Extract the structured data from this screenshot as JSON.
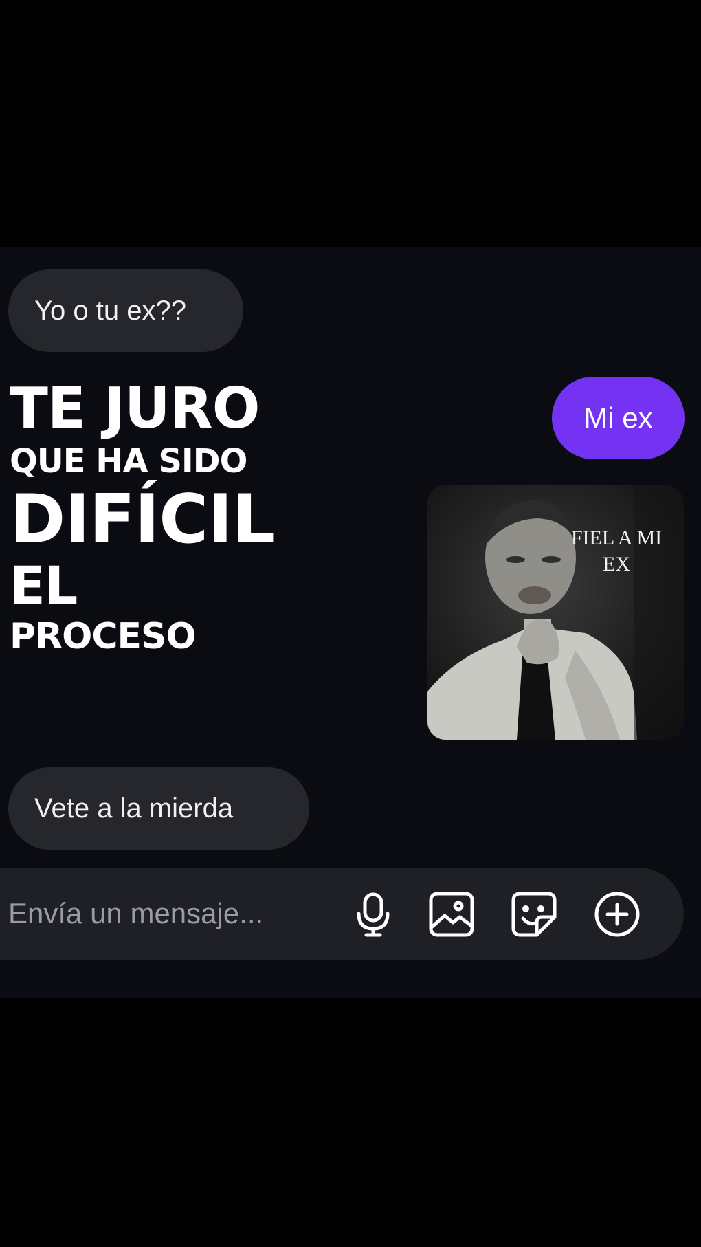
{
  "messages": {
    "first_received": "Yo o tu ex??",
    "sent": "Mi ex",
    "last_received": "Vete a la mierda"
  },
  "caption_lines": [
    "TE JURO",
    "QUE HA SIDO",
    "DIFÍCIL",
    "EL",
    "PROCESO"
  ],
  "gif_text": "FIEL A MI EX",
  "composer": {
    "placeholder": "Envía un mensaje...",
    "icons": [
      "microphone-icon",
      "image-icon",
      "sticker-icon",
      "plus-icon"
    ]
  },
  "colors": {
    "sent_bubble": "#7433f2",
    "received_bubble": "#26272c",
    "chat_background": "#0b0c11"
  }
}
